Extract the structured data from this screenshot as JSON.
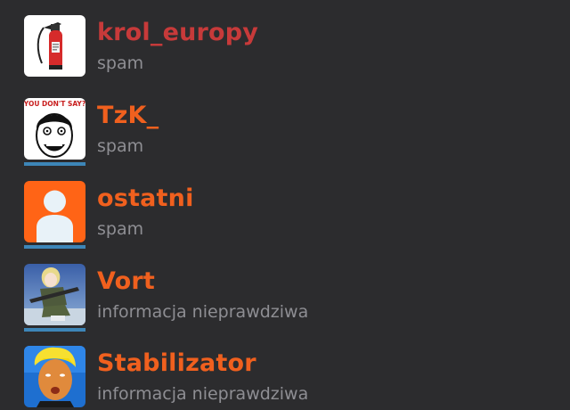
{
  "reports": [
    {
      "username": "krol_europy",
      "reason": "spam",
      "name_color": "#c73a3a",
      "avatar_icon": "fire-extinguisher-avatar",
      "has_underline": false
    },
    {
      "username": "TzK_",
      "reason": "spam",
      "name_color": "#f0601e",
      "avatar_icon": "you-dont-say-meme-avatar",
      "avatar_caption": "YOU DON'T SAY?",
      "has_underline": true
    },
    {
      "username": "ostatni",
      "reason": "spam",
      "name_color": "#f0601e",
      "avatar_icon": "default-user-avatar",
      "has_underline": true
    },
    {
      "username": "Vort",
      "reason": "informacja nieprawdziwa",
      "name_color": "#f0601e",
      "avatar_icon": "anime-soldier-avatar",
      "has_underline": true
    },
    {
      "username": "Stabilizator",
      "reason": "informacja nieprawdziwa",
      "name_color": "#f0601e",
      "avatar_icon": "trump-ukraine-colors-avatar",
      "has_underline": true
    }
  ],
  "colors": {
    "background": "#2c2c2e",
    "reason_text": "#8e8e93",
    "underline": "#3d86b8"
  }
}
